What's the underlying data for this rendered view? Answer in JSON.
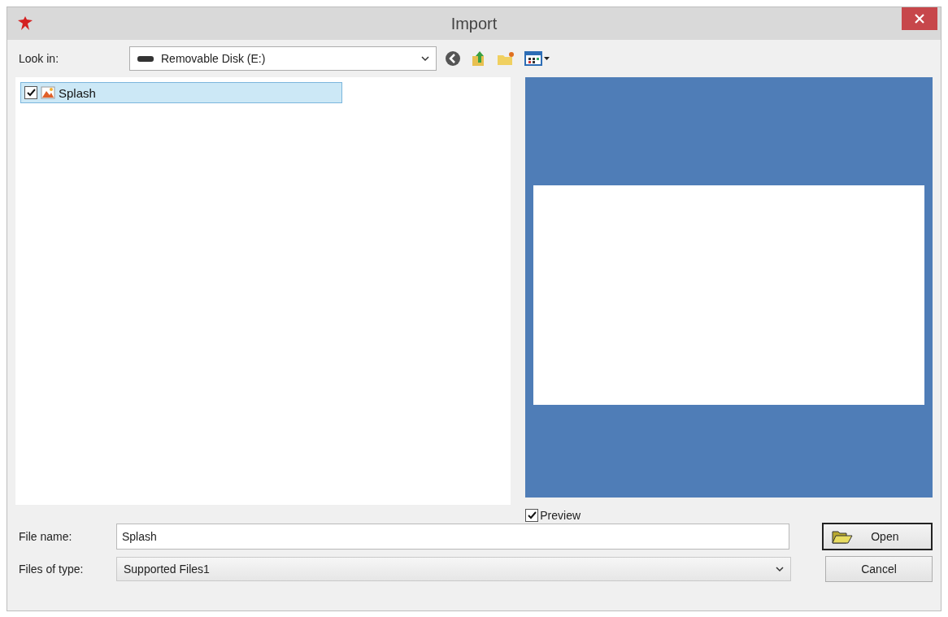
{
  "window": {
    "title": "Import"
  },
  "look_in": {
    "label": "Look in:",
    "value": "Removable Disk (E:)"
  },
  "files": [
    {
      "name": "Splash",
      "checked": true,
      "selected": true
    }
  ],
  "preview": {
    "label": "Preview",
    "checked": true
  },
  "file_name": {
    "label": "File name:",
    "value": "Splash"
  },
  "file_type": {
    "label": "Files of type:",
    "value": "Supported Files1"
  },
  "buttons": [
    {
      "label": "Open",
      "kind": "default"
    },
    {
      "label": "Cancel",
      "kind": "normal"
    }
  ]
}
